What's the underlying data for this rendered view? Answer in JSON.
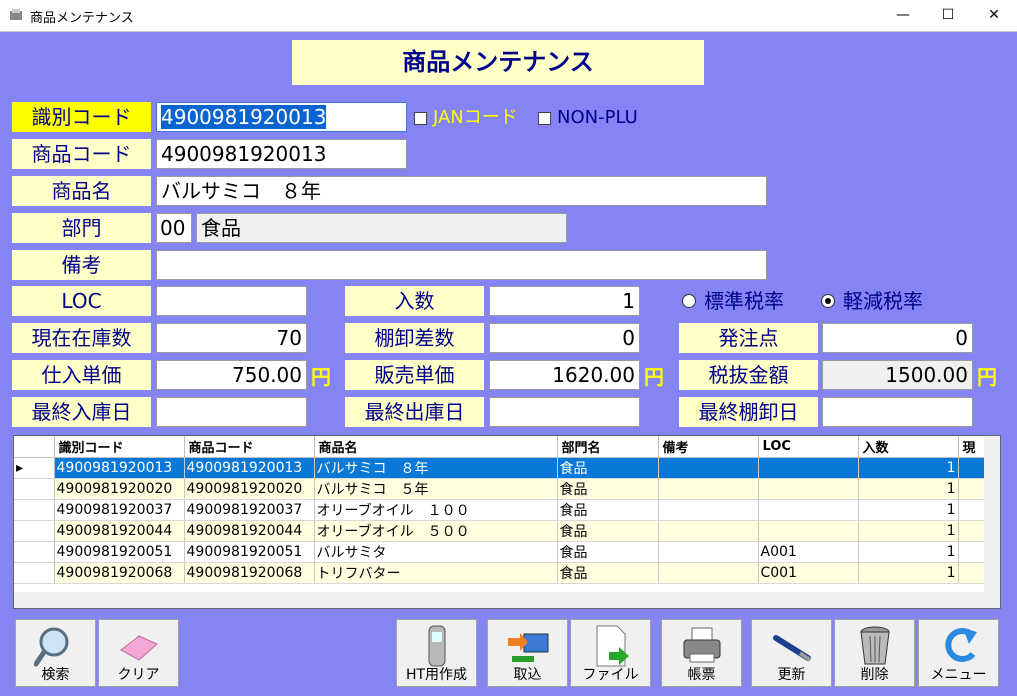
{
  "window": {
    "title": "商品メンテナンス",
    "minimize": "—",
    "maximize": "☐",
    "close": "✕"
  },
  "header": {
    "title": "商品メンテナンス"
  },
  "form": {
    "id_code_label": "識別コード",
    "id_code_value": "4900981920013",
    "jan_label": "JANコード",
    "nonplu_label": "NON-PLU",
    "product_code_label": "商品コード",
    "product_code_value": "4900981920013",
    "product_name_label": "商品名",
    "product_name_value": "バルサミコ　８年",
    "dept_label": "部門",
    "dept_code": "00",
    "dept_name": "食品",
    "remarks_label": "備考",
    "remarks_value": "",
    "loc_label": "LOC",
    "loc_value": "",
    "qty_label": "入数",
    "qty_value": "1",
    "std_tax_label": "標準税率",
    "reduced_tax_label": "軽減税率",
    "stock_label": "現在在庫数",
    "stock_value": "70",
    "inv_diff_label": "棚卸差数",
    "inv_diff_value": "0",
    "order_point_label": "発注点",
    "order_point_value": "0",
    "cost_label": "仕入単価",
    "cost_value": "750.00",
    "price_label": "販売単価",
    "price_value": "1620.00",
    "taxex_label": "税抜金額",
    "taxex_value": "1500.00",
    "yen": "円",
    "last_in_label": "最終入庫日",
    "last_in_value": "",
    "last_out_label": "最終出庫日",
    "last_out_value": "",
    "last_inv_label": "最終棚卸日",
    "last_inv_value": ""
  },
  "grid": {
    "columns": [
      "識別コード",
      "商品コード",
      "商品名",
      "部門名",
      "備考",
      "LOC",
      "入数",
      "現"
    ],
    "rows": [
      [
        "4900981920013",
        "4900981920013",
        "バルサミコ　８年",
        "食品",
        "",
        "",
        "1"
      ],
      [
        "4900981920020",
        "4900981920020",
        "バルサミコ　５年",
        "食品",
        "",
        "",
        "1"
      ],
      [
        "4900981920037",
        "4900981920037",
        "オリーブオイル　１００",
        "食品",
        "",
        "",
        "1"
      ],
      [
        "4900981920044",
        "4900981920044",
        "オリーブオイル　５００",
        "食品",
        "",
        "",
        "1"
      ],
      [
        "4900981920051",
        "4900981920051",
        "バルサミタ",
        "食品",
        "",
        "A001",
        "1"
      ],
      [
        "4900981920068",
        "4900981920068",
        "トリフバター",
        "食品",
        "",
        "C001",
        "1"
      ]
    ]
  },
  "buttons": {
    "search": "検索",
    "clear": "クリア",
    "ht": "HT用作成",
    "import": "取込",
    "file": "ファイル",
    "report": "帳票",
    "update": "更新",
    "delete": "削除",
    "menu": "メニュー"
  }
}
